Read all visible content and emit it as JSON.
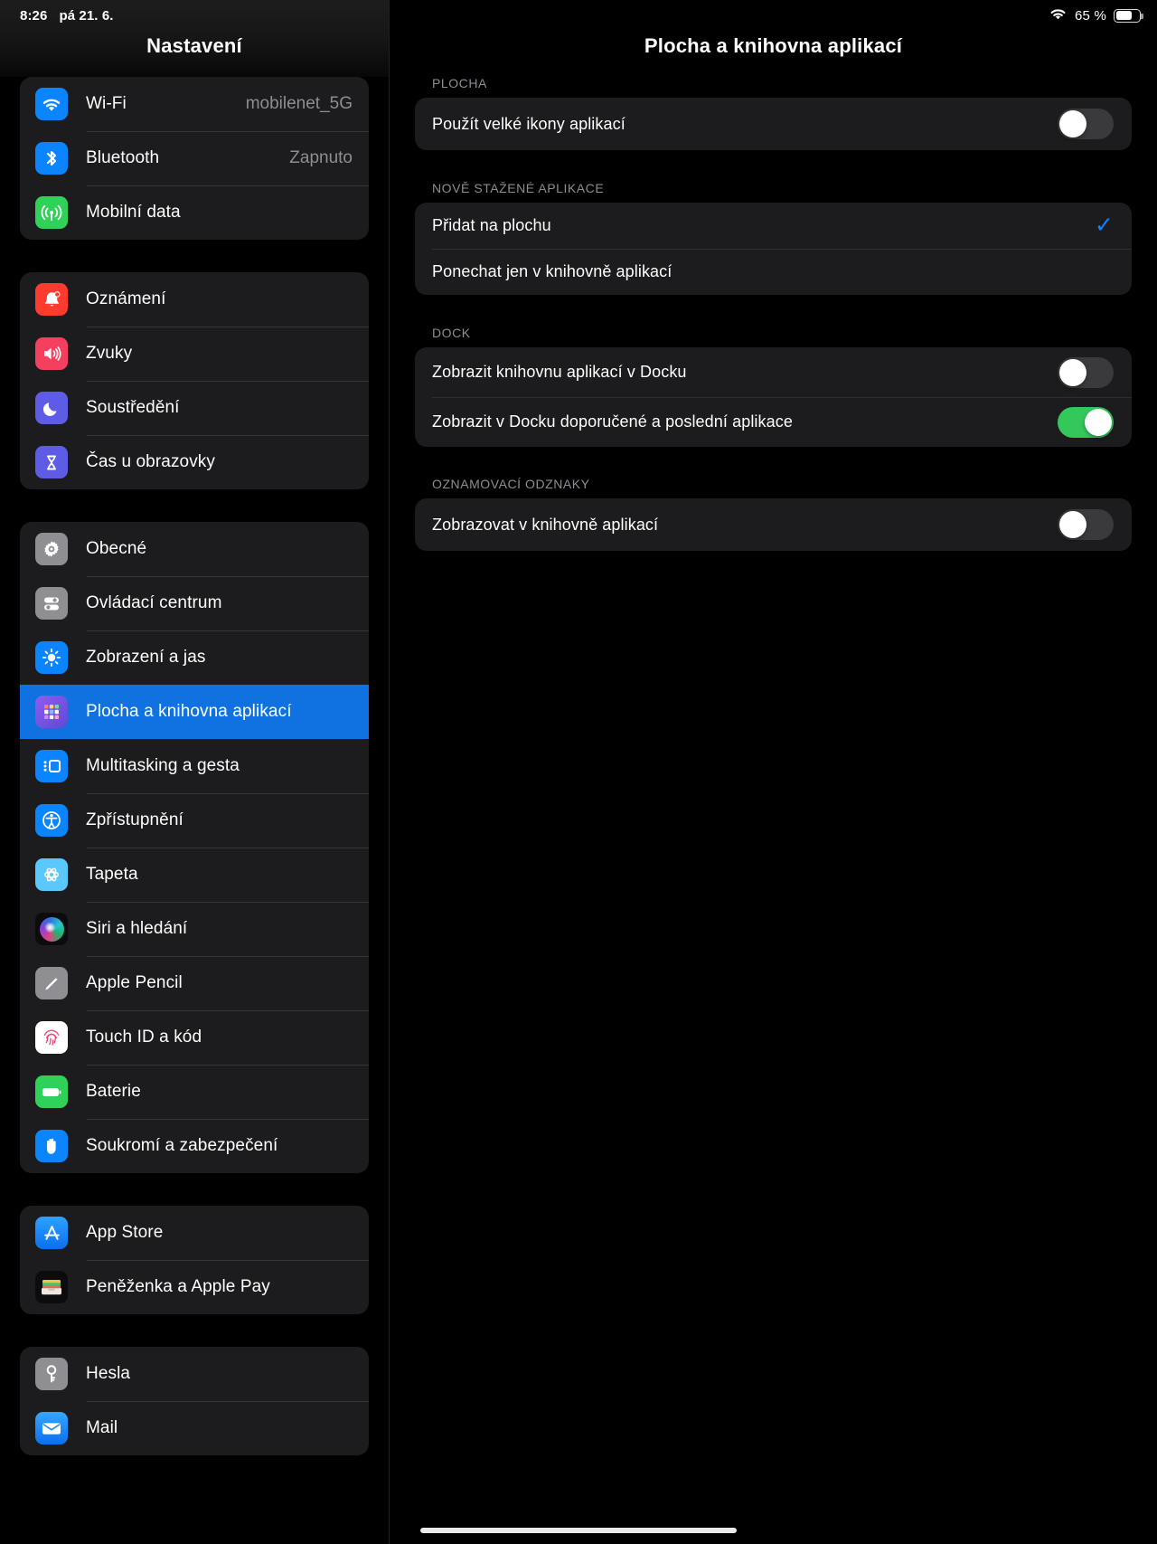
{
  "status_bar": {
    "time": "8:26",
    "date": "pá 21. 6.",
    "wifi_icon": "wifi-icon",
    "battery_percent": "65 %",
    "battery_level": 62
  },
  "sidebar": {
    "title": "Nastavení",
    "groups": [
      {
        "id": "connectivity",
        "items": [
          {
            "label": "Wi-Fi",
            "value": "mobilenet_5G",
            "icon": "wifi-icon",
            "color": "#0a84ff"
          },
          {
            "label": "Bluetooth",
            "value": "Zapnuto",
            "icon": "bluetooth-icon",
            "color": "#0a84ff"
          },
          {
            "label": "Mobilní data",
            "value": "",
            "icon": "cellular-icon",
            "color": "#30d158"
          }
        ]
      },
      {
        "id": "alerts",
        "items": [
          {
            "label": "Oznámení",
            "value": "",
            "icon": "bell-icon",
            "color": "#ff3b30"
          },
          {
            "label": "Zvuky",
            "value": "",
            "icon": "speaker-icon",
            "color": "#f43f5e"
          },
          {
            "label": "Soustředění",
            "value": "",
            "icon": "moon-icon",
            "color": "#5e5ce6"
          },
          {
            "label": "Čas u obrazovky",
            "value": "",
            "icon": "hourglass-icon",
            "color": "#5e5ce6"
          }
        ]
      },
      {
        "id": "system",
        "items": [
          {
            "label": "Obecné",
            "value": "",
            "icon": "gear-icon",
            "color": "#8e8e93"
          },
          {
            "label": "Ovládací centrum",
            "value": "",
            "icon": "control-center-icon",
            "color": "#8e8e93"
          },
          {
            "label": "Zobrazení a jas",
            "value": "",
            "icon": "brightness-icon",
            "color": "#0a84ff"
          },
          {
            "label": "Plocha a knihovna aplikací",
            "value": "",
            "icon": "app-grid-icon",
            "color": "#5e5ce6",
            "selected": true
          },
          {
            "label": "Multitasking a gesta",
            "value": "",
            "icon": "multitasking-icon",
            "color": "#0a84ff"
          },
          {
            "label": "Zpřístupnění",
            "value": "",
            "icon": "accessibility-icon",
            "color": "#0a84ff"
          },
          {
            "label": "Tapeta",
            "value": "",
            "icon": "wallpaper-icon",
            "color": "#5ac8fa"
          },
          {
            "label": "Siri a hledání",
            "value": "",
            "icon": "siri-icon",
            "color": "#1c1c1e"
          },
          {
            "label": "Apple Pencil",
            "value": "",
            "icon": "pencil-icon",
            "color": "#8e8e93"
          },
          {
            "label": "Touch ID a kód",
            "value": "",
            "icon": "fingerprint-icon",
            "color": "#ffffff"
          },
          {
            "label": "Baterie",
            "value": "",
            "icon": "battery-icon",
            "color": "#30d158"
          },
          {
            "label": "Soukromí a zabezpečení",
            "value": "",
            "icon": "hand-icon",
            "color": "#0a84ff"
          }
        ]
      },
      {
        "id": "store",
        "items": [
          {
            "label": "App Store",
            "value": "",
            "icon": "app-store-icon",
            "color": "#0a84ff"
          },
          {
            "label": "Peněženka a Apple Pay",
            "value": "",
            "icon": "wallet-icon",
            "color": "#1c1c1e"
          }
        ]
      },
      {
        "id": "accounts",
        "items": [
          {
            "label": "Hesla",
            "value": "",
            "icon": "key-icon",
            "color": "#8e8e93"
          },
          {
            "label": "Mail",
            "value": "",
            "icon": "mail-icon",
            "color": "#0a84ff"
          }
        ]
      }
    ]
  },
  "detail": {
    "title": "Plocha a knihovna aplikací",
    "sections": [
      {
        "id": "plocha",
        "header": "PLOCHA",
        "rows": [
          {
            "label": "Použít velké ikony aplikací",
            "control": "toggle",
            "on": false
          }
        ]
      },
      {
        "id": "nove-stazene",
        "header": "NOVĚ STAŽENÉ APLIKACE",
        "rows": [
          {
            "label": "Přidat na plochu",
            "control": "check",
            "on": true,
            "check_glyph": "✓"
          },
          {
            "label": "Ponechat jen v knihovně aplikací",
            "control": "none",
            "on": false
          }
        ]
      },
      {
        "id": "dock",
        "header": "DOCK",
        "rows": [
          {
            "label": "Zobrazit knihovnu aplikací v Docku",
            "control": "toggle",
            "on": false
          },
          {
            "label": "Zobrazit v Docku doporučené a poslední aplikace",
            "control": "toggle",
            "on": true
          }
        ]
      },
      {
        "id": "odznaky",
        "header": "OZNAMOVACÍ ODZNAKY",
        "rows": [
          {
            "label": "Zobrazovat v knihovně aplikací",
            "control": "toggle",
            "on": false
          }
        ]
      }
    ]
  },
  "colors": {
    "accent_blue": "#0a84ff",
    "selection_blue": "#1072e0",
    "toggle_on_green": "#34c759",
    "toggle_off_gray": "#3a3a3c",
    "card_bg": "#1c1c1e",
    "page_bg": "#000000",
    "secondary_text": "#8d8d93"
  }
}
